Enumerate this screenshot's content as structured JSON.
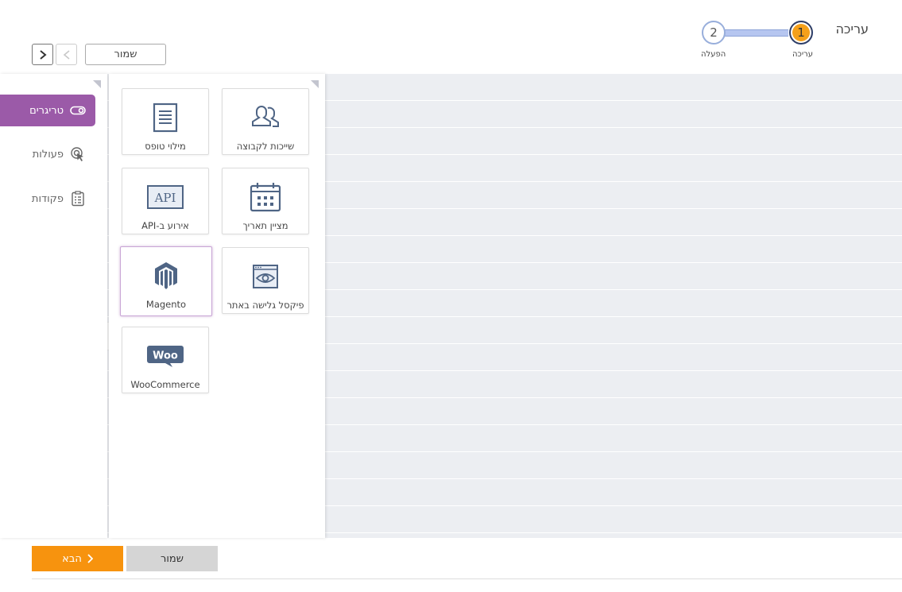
{
  "header": {
    "title": "עריכה",
    "save_label": "שמור"
  },
  "stepper": {
    "steps": [
      {
        "number": "1",
        "label": "עריכה",
        "state": "active"
      },
      {
        "number": "2",
        "label": "הפעלה",
        "state": "pending"
      }
    ]
  },
  "categories": [
    {
      "label": "טריגרים",
      "icon": "toggle-icon",
      "active": true
    },
    {
      "label": "פעולות",
      "icon": "cursor-click-icon",
      "active": false
    },
    {
      "label": "פקודות",
      "icon": "clipboard-list-icon",
      "active": false
    }
  ],
  "tiles": [
    {
      "label": "שייכות לקבוצה",
      "icon": "users-group-icon"
    },
    {
      "label": "מילוי טופס",
      "icon": "form-document-icon"
    },
    {
      "label": "מציין תאריך",
      "icon": "calendar-icon"
    },
    {
      "label": "אירוע ב-API",
      "icon": "api-icon"
    },
    {
      "label": "פיקסל גלישה באתר",
      "icon": "browser-eye-icon"
    },
    {
      "label": "Magento",
      "icon": "magento-logo-icon",
      "selected": true
    },
    {
      "label": "WooCommerce",
      "icon": "woo-logo-icon"
    }
  ],
  "footer": {
    "next_label": "הבא",
    "save_label": "שמור"
  },
  "colors": {
    "accent_orange": "#f7930e",
    "active_purple": "#9b5aa8",
    "step_active": "#f5a01a",
    "icon_slate": "#4f6585"
  }
}
